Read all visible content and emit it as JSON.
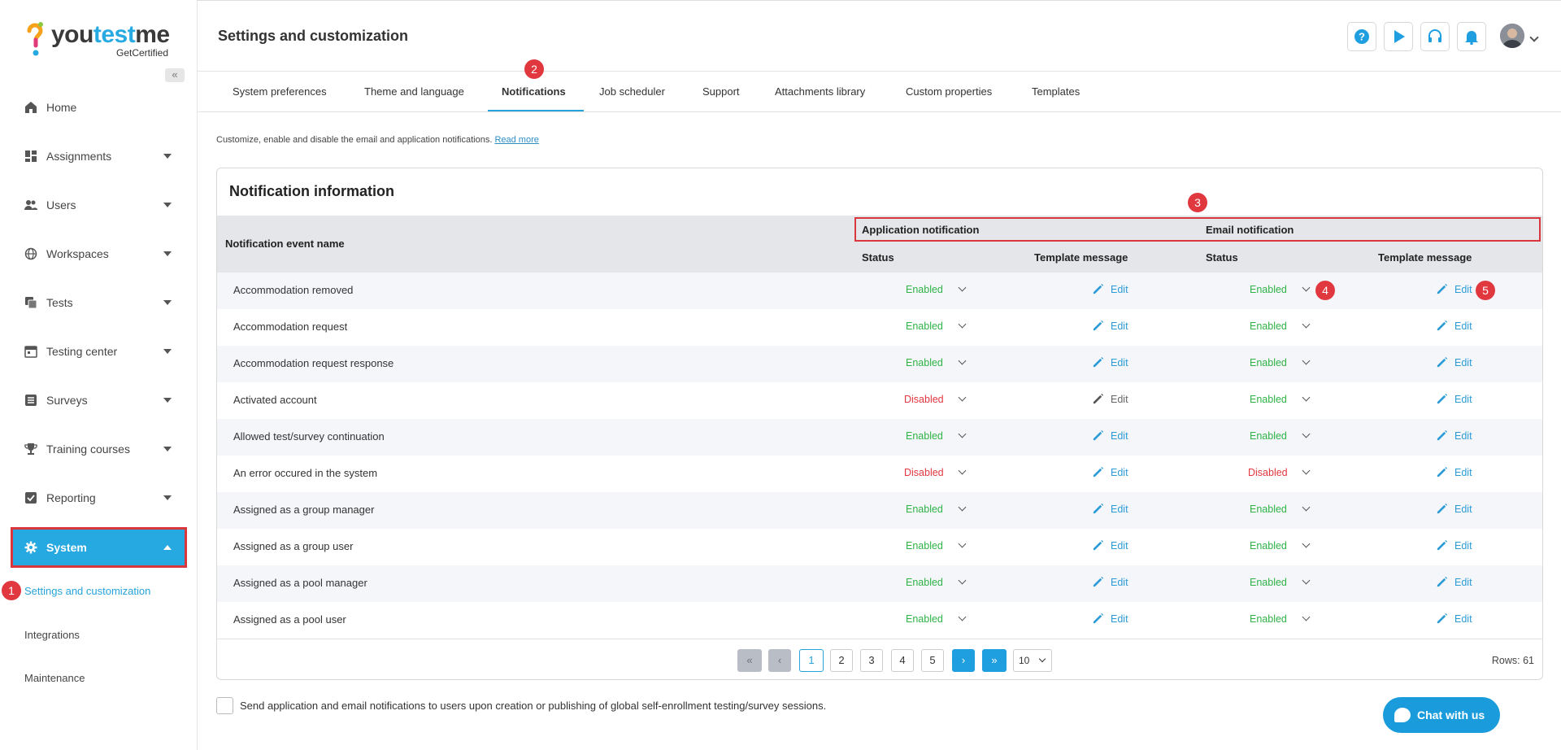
{
  "brand": {
    "name_a": "you",
    "name_b": "test",
    "name_c": "me",
    "sub": "GetCertified"
  },
  "sidebar": {
    "collapse_glyph": "«",
    "items": [
      {
        "label": "Home",
        "icon": "home-icon"
      },
      {
        "label": "Assignments",
        "icon": "dashboard-icon"
      },
      {
        "label": "Users",
        "icon": "users-icon"
      },
      {
        "label": "Workspaces",
        "icon": "globe-icon"
      },
      {
        "label": "Tests",
        "icon": "copy-icon"
      },
      {
        "label": "Testing center",
        "icon": "calendar-icon"
      },
      {
        "label": "Surveys",
        "icon": "list-icon"
      },
      {
        "label": "Training courses",
        "icon": "trophy-icon"
      },
      {
        "label": "Reporting",
        "icon": "chart-icon"
      },
      {
        "label": "System",
        "icon": "gear-icon"
      }
    ],
    "sub_items": [
      "Settings and customization",
      "Integrations",
      "Maintenance"
    ]
  },
  "header": {
    "title": "Settings and customization"
  },
  "tabs": [
    "System preferences",
    "Theme and language",
    "Notifications",
    "Job scheduler",
    "Support",
    "Attachments library",
    "Custom properties",
    "Templates"
  ],
  "intro": {
    "text": "Customize, enable and disable the email and application notifications.",
    "link": "Read more"
  },
  "card": {
    "title": "Notification information",
    "headers": {
      "name": "Notification event name",
      "app_group": "Application notification",
      "email_group": "Email notification",
      "status": "Status",
      "template": "Template message"
    },
    "edit_label": "Edit",
    "rows": [
      {
        "name": "Accommodation removed",
        "app_status": "Enabled",
        "email_status": "Enabled"
      },
      {
        "name": "Accommodation request",
        "app_status": "Enabled",
        "email_status": "Enabled"
      },
      {
        "name": "Accommodation request response",
        "app_status": "Enabled",
        "email_status": "Enabled"
      },
      {
        "name": "Activated account",
        "app_status": "Disabled",
        "email_status": "Enabled"
      },
      {
        "name": "Allowed test/survey continuation",
        "app_status": "Enabled",
        "email_status": "Enabled"
      },
      {
        "name": "An error occured in the system",
        "app_status": "Disabled",
        "email_status": "Disabled"
      },
      {
        "name": "Assigned as a group manager",
        "app_status": "Enabled",
        "email_status": "Enabled"
      },
      {
        "name": "Assigned as a group user",
        "app_status": "Enabled",
        "email_status": "Enabled"
      },
      {
        "name": "Assigned as a pool manager",
        "app_status": "Enabled",
        "email_status": "Enabled"
      },
      {
        "name": "Assigned as a pool user",
        "app_status": "Enabled",
        "email_status": "Enabled"
      }
    ]
  },
  "pagination": {
    "pages": [
      "1",
      "2",
      "3",
      "4",
      "5"
    ],
    "current": "1",
    "page_size": "10",
    "rows_label": "Rows: 61"
  },
  "footer_checkbox": "Send application and email notifications to users upon creation or publishing of global self-enrollment testing/survey sessions.",
  "chat": {
    "label": "Chat with us"
  },
  "badges": [
    "1",
    "2",
    "3",
    "4",
    "5"
  ],
  "colors": {
    "accent": "#27a3d9",
    "enabled": "#2fb346",
    "disabled": "#e2373f",
    "highlight": "#d9363e"
  }
}
